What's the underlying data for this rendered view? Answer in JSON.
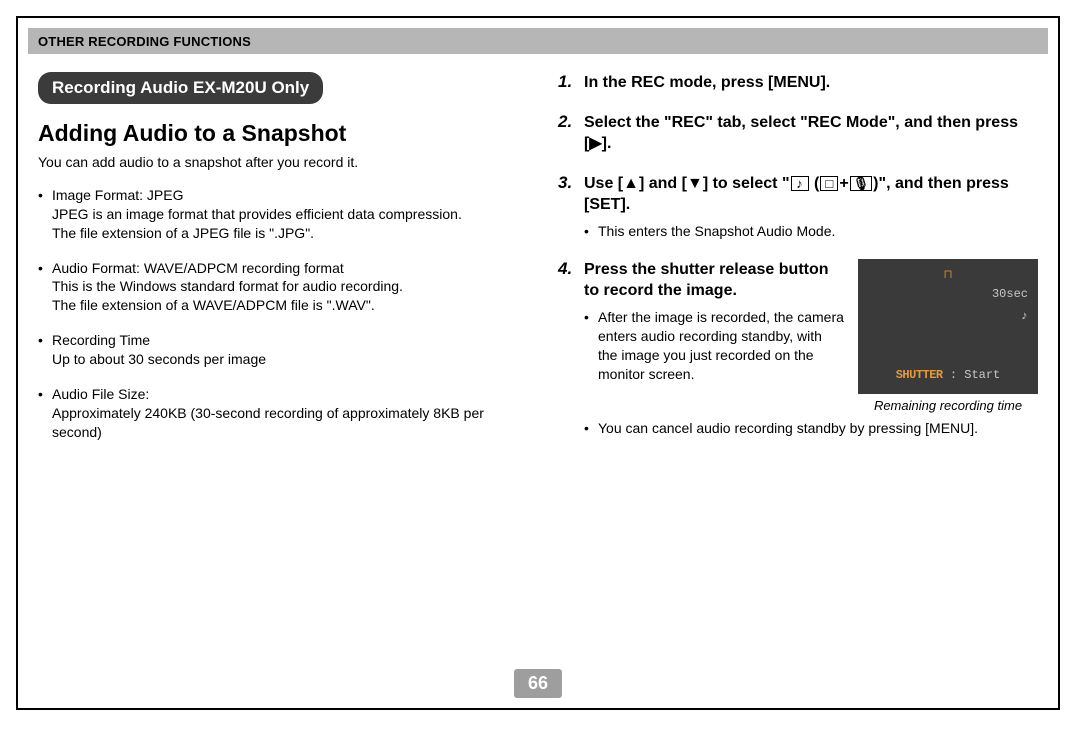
{
  "header": {
    "title": "OTHER RECORDING FUNCTIONS"
  },
  "left": {
    "pill": "Recording Audio EX-M20U Only",
    "heading": "Adding Audio to a Snapshot",
    "intro": "You can add audio to a snapshot after you record it.",
    "bullets": [
      {
        "lead": "Image Format: JPEG",
        "body": "JPEG is an image format that provides efficient data compression.\nThe file extension of a JPEG file is \".JPG\"."
      },
      {
        "lead": "Audio Format: WAVE/ADPCM recording format",
        "body": "This is the Windows standard format for audio recording.\nThe file extension of a WAVE/ADPCM file is \".WAV\"."
      },
      {
        "lead": "Recording Time",
        "body": "Up to about 30 seconds per image"
      },
      {
        "lead": "Audio File Size:",
        "body": "Approximately 240KB (30-second recording of approximately 8KB per second)"
      }
    ]
  },
  "right": {
    "steps": [
      {
        "title_pre": "In the REC mode, press [MENU].",
        "title_post": "",
        "sub": []
      },
      {
        "title_pre": "Select the \"REC\" tab, select \"REC Mode\", and then press [",
        "tri": "▶",
        "title_post": "].",
        "sub": []
      },
      {
        "title_pre": "Use [",
        "tri_up": "▲",
        "mid1": "] and [",
        "tri_down": "▼",
        "mid2": "] to select \"",
        "icon_text1": "",
        "mid3": " (",
        "icon_text2": "",
        "mid4": "+",
        "icon_text3": "",
        "mid5": ")\", and then press [SET].",
        "sub": [
          "This enters the Snapshot Audio Mode."
        ]
      },
      {
        "title_pre": "Press the shutter release button to record the image.",
        "sub": [
          "After the image is recorded, the camera enters audio recording standby, with the image you just recorded on the monitor screen.",
          "You can cancel audio recording standby by pressing [MENU]."
        ]
      }
    ],
    "lcd": {
      "timer": "30sec",
      "shutter_label": "SHUTTER",
      "start_label": ": Start",
      "caption": "Remaining recording time"
    }
  },
  "page_number": "66"
}
